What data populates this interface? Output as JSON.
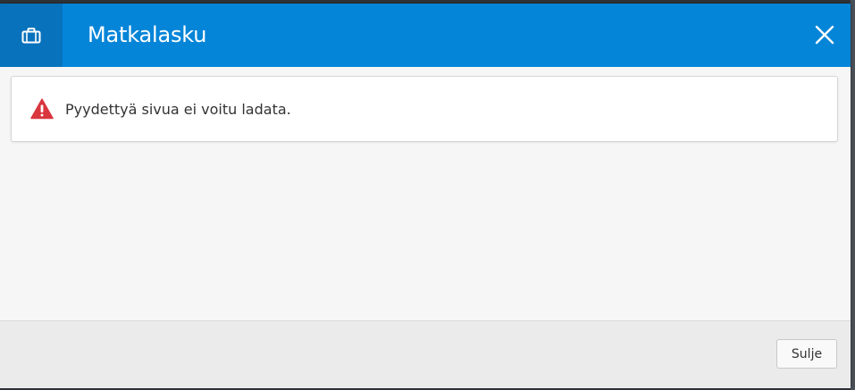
{
  "dialog": {
    "title": "Matkalasku",
    "header_icon": "briefcase-icon",
    "close_icon": "close-icon"
  },
  "alert": {
    "icon": "warning-icon",
    "message": "Pyydettyä sivua ei voitu ladata."
  },
  "footer": {
    "close_label": "Sulje"
  },
  "colors": {
    "header": "#0585d8",
    "header_icon_box": "#0872bd",
    "warning": "#d9363e",
    "content_bg": "#f6f6f6",
    "footer_bg": "#ebebeb"
  }
}
